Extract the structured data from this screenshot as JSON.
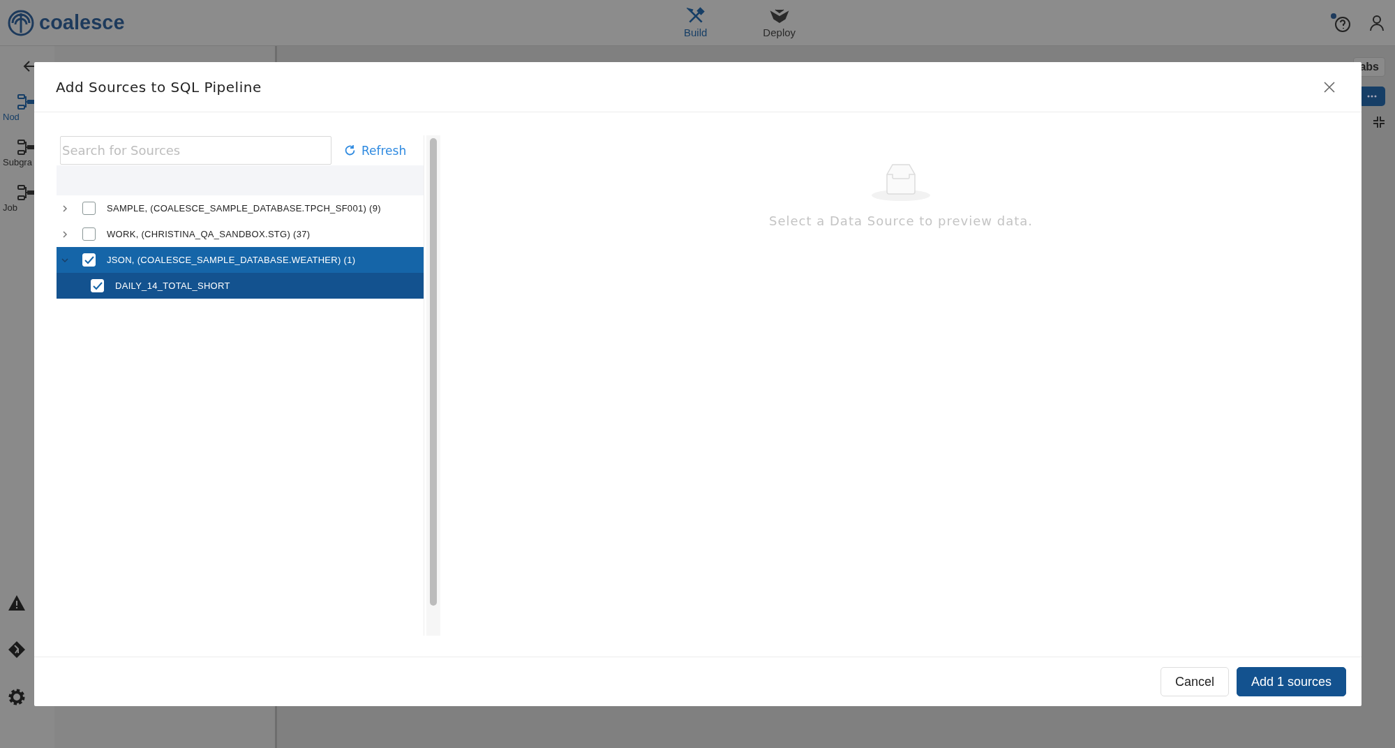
{
  "app": {
    "logo": "coalesce",
    "nav": [
      {
        "label": "Build",
        "selected": true
      },
      {
        "label": "Deploy",
        "selected": false
      }
    ]
  },
  "sidebar": {
    "items": [
      {
        "label": "Nod",
        "selected": true
      },
      {
        "label": "Subgra",
        "selected": false
      },
      {
        "label": "Job",
        "selected": false
      }
    ]
  },
  "background": {
    "tabs_button": "abs"
  },
  "dialog": {
    "title": "Add Sources to SQL Pipeline",
    "search": {
      "placeholder": "Search for Sources"
    },
    "refresh": "Refresh",
    "tree": [
      {
        "label": "SAMPLE, (COALESCE_SAMPLE_DATABASE.TPCH_SF001) (9)",
        "checked": false,
        "expanded": false,
        "selected": false
      },
      {
        "label": "WORK, (CHRISTINA_QA_SANDBOX.STG) (37)",
        "checked": false,
        "expanded": false,
        "selected": false
      },
      {
        "label": "JSON, (COALESCE_SAMPLE_DATABASE.WEATHER) (1)",
        "checked": true,
        "expanded": true,
        "selected": true,
        "children": [
          {
            "label": "DAILY_14_TOTAL_SHORT",
            "checked": true,
            "selected": true
          }
        ]
      }
    ],
    "empty_message": "Select a Data Source to preview data.",
    "buttons": [
      {
        "label": "Cancel",
        "kind": "secondary"
      },
      {
        "label": "Add 1 sources",
        "kind": "primary"
      }
    ]
  }
}
